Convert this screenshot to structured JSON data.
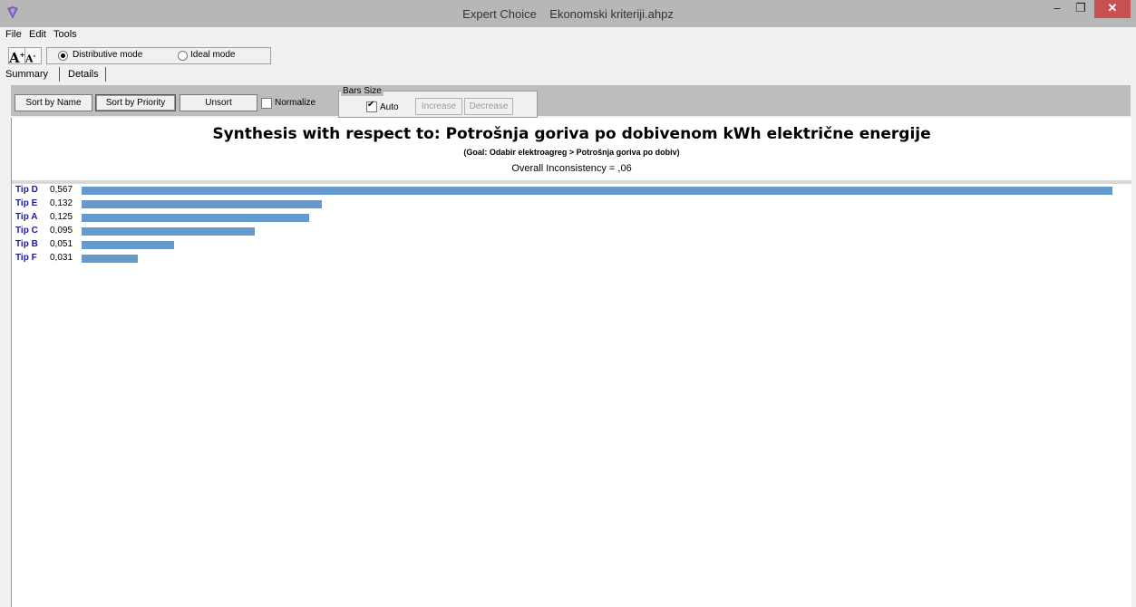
{
  "window": {
    "app_name": "Expert Choice",
    "file_name": "Ekonomski kriteriji.ahpz",
    "minimize": "–",
    "maximize": "❐",
    "close": "✕"
  },
  "menu": [
    "File",
    "Edit",
    "Tools"
  ],
  "mode": {
    "distributive_label": "Distributive mode",
    "ideal_label": "Ideal mode",
    "selected": "distributive"
  },
  "font_buttons": {
    "increase": "A",
    "decrease": "A"
  },
  "tabs": [
    "Summary",
    "Details"
  ],
  "controls": {
    "sort_by_name": "Sort by Name",
    "sort_by_priority": "Sort by Priority",
    "unsort": "Unsort",
    "normalize": "Normalize",
    "bars_size": "Bars Size",
    "auto": "Auto",
    "increase": "Increase",
    "decrease": "Decrease"
  },
  "synthesis": {
    "title": "Synthesis with respect to: Potrošnja goriva po dobivenom kWh električne energije",
    "goal": "(Goal: Odabir elektroagreg > Potrošnja goriva po dobiv)",
    "inconsistency": "Overall Inconsistency = ,06"
  },
  "chart_data": {
    "type": "bar",
    "orientation": "horizontal",
    "categories": [
      "Tip D",
      "Tip E",
      "Tip A",
      "Tip C",
      "Tip B",
      "Tip F"
    ],
    "values": [
      0.567,
      0.132,
      0.125,
      0.095,
      0.051,
      0.031
    ],
    "value_labels": [
      "0,567",
      "0,132",
      "0,125",
      "0,095",
      "0,051",
      "0,031"
    ],
    "bar_color": "#6699cc",
    "label_color": "#1a1aa0"
  }
}
